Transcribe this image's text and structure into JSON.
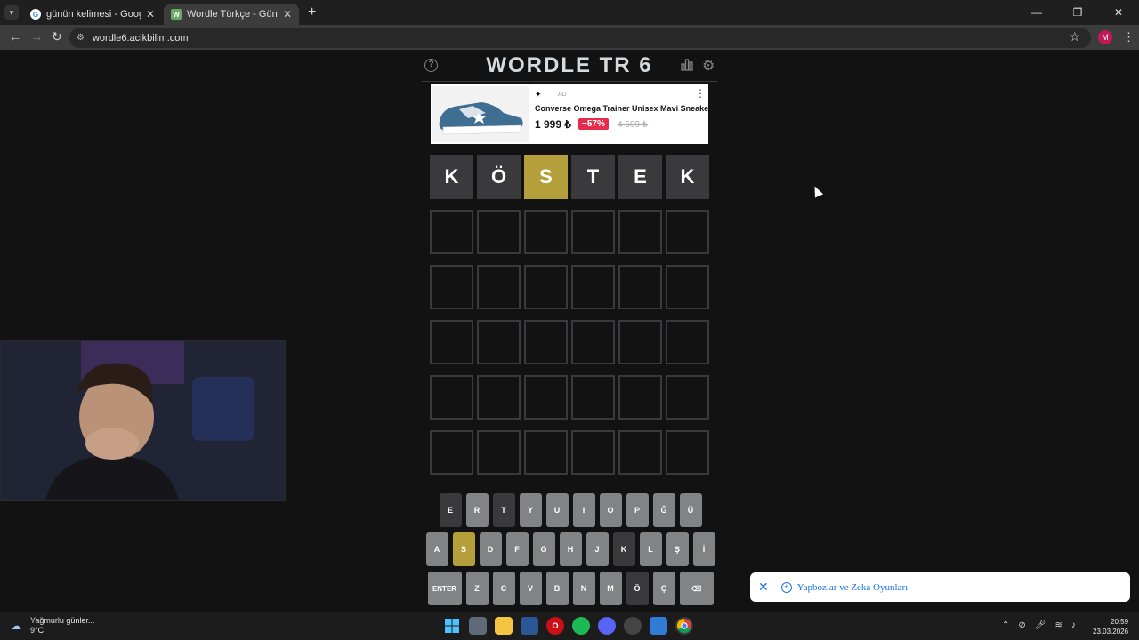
{
  "browser": {
    "tabs": [
      {
        "title": "günün kelimesi - Google Search",
        "close": "✕"
      },
      {
        "title": "Wordle Türkçe - Günlük Kelime",
        "close": "✕"
      }
    ],
    "new_tab": "+",
    "url": "wordle6.acikbilim.com",
    "profile_initial": "M",
    "window_buttons": {
      "minimize": "—",
      "restore": "❐",
      "close": "✕"
    }
  },
  "game": {
    "title": "WORDLE TR 6",
    "help": "?",
    "board": [
      [
        {
          "letter": "K",
          "state": "absent"
        },
        {
          "letter": "Ö",
          "state": "absent"
        },
        {
          "letter": "S",
          "state": "present"
        },
        {
          "letter": "T",
          "state": "absent"
        },
        {
          "letter": "E",
          "state": "absent"
        },
        {
          "letter": "K",
          "state": "absent"
        }
      ],
      [
        {
          "letter": "",
          "state": "empty"
        },
        {
          "letter": "",
          "state": "empty"
        },
        {
          "letter": "",
          "state": "empty"
        },
        {
          "letter": "",
          "state": "empty"
        },
        {
          "letter": "",
          "state": "empty"
        },
        {
          "letter": "",
          "state": "empty"
        }
      ],
      [
        {
          "letter": "",
          "state": "empty"
        },
        {
          "letter": "",
          "state": "empty"
        },
        {
          "letter": "",
          "state": "empty"
        },
        {
          "letter": "",
          "state": "empty"
        },
        {
          "letter": "",
          "state": "empty"
        },
        {
          "letter": "",
          "state": "empty"
        }
      ],
      [
        {
          "letter": "",
          "state": "empty"
        },
        {
          "letter": "",
          "state": "empty"
        },
        {
          "letter": "",
          "state": "empty"
        },
        {
          "letter": "",
          "state": "empty"
        },
        {
          "letter": "",
          "state": "empty"
        },
        {
          "letter": "",
          "state": "empty"
        }
      ],
      [
        {
          "letter": "",
          "state": "empty"
        },
        {
          "letter": "",
          "state": "empty"
        },
        {
          "letter": "",
          "state": "empty"
        },
        {
          "letter": "",
          "state": "empty"
        },
        {
          "letter": "",
          "state": "empty"
        },
        {
          "letter": "",
          "state": "empty"
        }
      ],
      [
        {
          "letter": "",
          "state": "empty"
        },
        {
          "letter": "",
          "state": "empty"
        },
        {
          "letter": "",
          "state": "empty"
        },
        {
          "letter": "",
          "state": "empty"
        },
        {
          "letter": "",
          "state": "empty"
        },
        {
          "letter": "",
          "state": "empty"
        }
      ]
    ],
    "keyboard": [
      [
        {
          "k": "E",
          "state": "absent"
        },
        {
          "k": "R",
          "state": "unused"
        },
        {
          "k": "T",
          "state": "absent"
        },
        {
          "k": "Y",
          "state": "unused"
        },
        {
          "k": "U",
          "state": "unused"
        },
        {
          "k": "I",
          "state": "unused"
        },
        {
          "k": "O",
          "state": "unused"
        },
        {
          "k": "P",
          "state": "unused"
        },
        {
          "k": "Ğ",
          "state": "unused"
        },
        {
          "k": "Ü",
          "state": "unused"
        }
      ],
      [
        {
          "k": "A",
          "state": "unused"
        },
        {
          "k": "S",
          "state": "present"
        },
        {
          "k": "D",
          "state": "unused"
        },
        {
          "k": "F",
          "state": "unused"
        },
        {
          "k": "G",
          "state": "unused"
        },
        {
          "k": "H",
          "state": "unused"
        },
        {
          "k": "J",
          "state": "unused"
        },
        {
          "k": "K",
          "state": "absent"
        },
        {
          "k": "L",
          "state": "unused"
        },
        {
          "k": "Ş",
          "state": "unused"
        },
        {
          "k": "İ",
          "state": "unused"
        }
      ],
      [
        {
          "k": "ENTER",
          "state": "wide"
        },
        {
          "k": "Z",
          "state": "unused"
        },
        {
          "k": "C",
          "state": "unused"
        },
        {
          "k": "V",
          "state": "unused"
        },
        {
          "k": "B",
          "state": "unused"
        },
        {
          "k": "N",
          "state": "unused"
        },
        {
          "k": "M",
          "state": "unused"
        },
        {
          "k": "Ö",
          "state": "absent"
        },
        {
          "k": "Ç",
          "state": "unused"
        },
        {
          "k": "⌫",
          "state": "wide"
        }
      ]
    ]
  },
  "ad": {
    "tag": "AD",
    "product": "Converse Omega Trainer Unisex Mavi Sneaker",
    "price": "1 999 ₺",
    "discount": "−57%",
    "old_price": "4 599 ₺"
  },
  "toast": {
    "close": "✕",
    "link": "Yapbozlar ve Zeka Oyunları"
  },
  "taskbar": {
    "weather_text": "Yağmurlu günler...",
    "temperature": "9°C",
    "time": "20:59",
    "date": "23.03.2026"
  },
  "colors": {
    "present": "#b59f3b",
    "absent": "#3a3a3c",
    "unused_key": "#818384",
    "background": "#121213"
  }
}
